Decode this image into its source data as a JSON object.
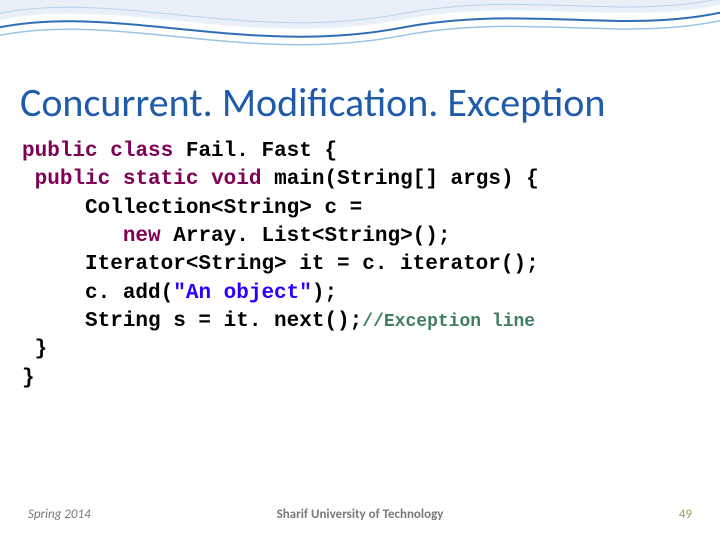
{
  "title": "Concurrent. Modification. Exception",
  "code": {
    "kw_public1": "public",
    "kw_class": "class",
    "cls_name": " Fail. Fast {",
    "indent1": " ",
    "kw_public2": "public",
    "kw_static": "static",
    "kw_void": "void",
    "sig": " main(String[] args) {",
    "l3": "     Collection<String> c = ",
    "l4a": "        ",
    "kw_new1": "new",
    "l4b": " Array. List<String>();",
    "l5": "     Iterator<String> it = c. iterator();",
    "l6a": "     c. add(",
    "str1": "\"An object\"",
    "l6b": ");",
    "l7a": "     String s = it. next();",
    "cmt1": "//Exception line",
    "l8": " }",
    "l9": "}"
  },
  "footer": {
    "left": "Spring 2014",
    "center": "Sharif University of Technology",
    "right": "49"
  }
}
